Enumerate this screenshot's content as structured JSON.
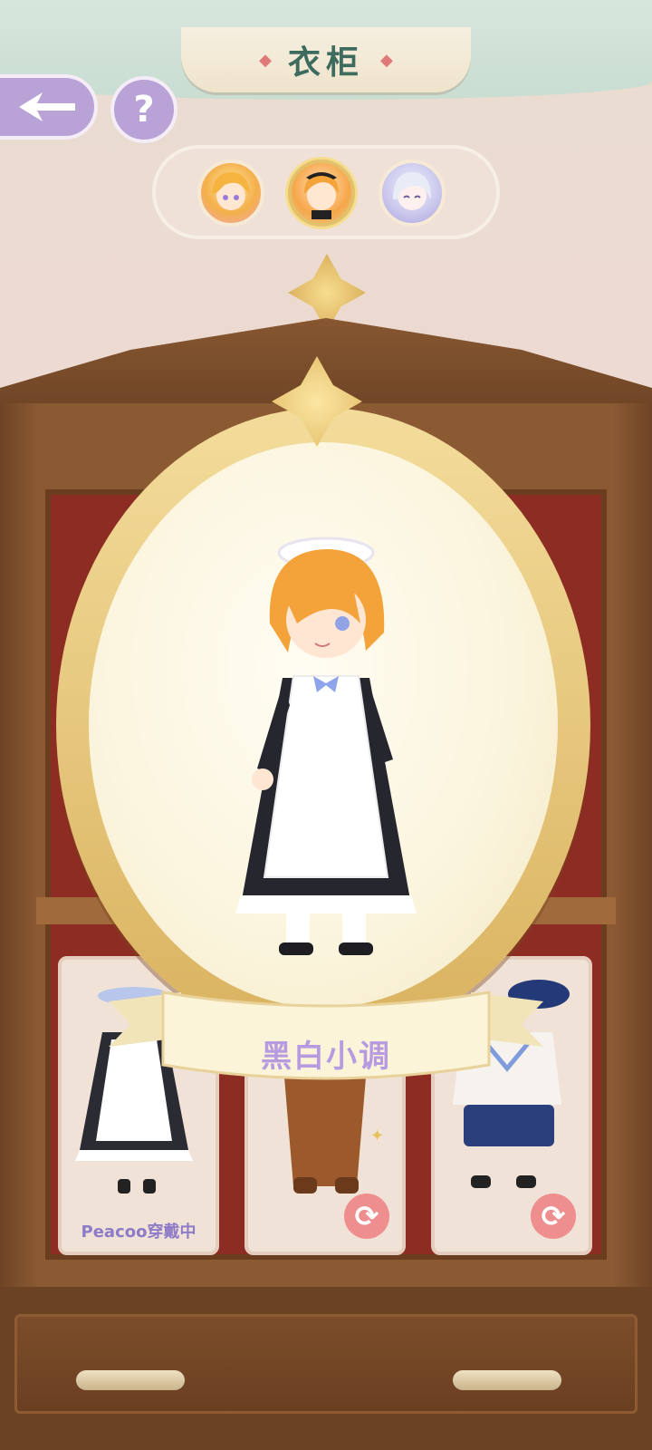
{
  "header": {
    "title": "衣柜"
  },
  "characters": [
    {
      "name": "character-blonde",
      "selected": false
    },
    {
      "name": "character-maid",
      "selected": true
    },
    {
      "name": "character-silver",
      "selected": false
    }
  ],
  "mirror": {
    "outfit_name": "黑白小调"
  },
  "outfits": [
    {
      "id": "maid-outfit",
      "status_label": "Peacoo穿戴中"
    },
    {
      "id": "bear-outfit",
      "status_label": ""
    },
    {
      "id": "sailor-outfit",
      "status_label": ""
    }
  ],
  "colors": {
    "accent_purple": "#b9a2d6",
    "label_purple": "#8e7bc7",
    "swap_pink": "#ee8e8f",
    "wood_brown": "#8b5a33",
    "gold": "#e3c06a"
  },
  "icons": {
    "back": "back-arrow-icon",
    "help": "question-mark-icon",
    "swap": "swap-arrows-icon"
  }
}
